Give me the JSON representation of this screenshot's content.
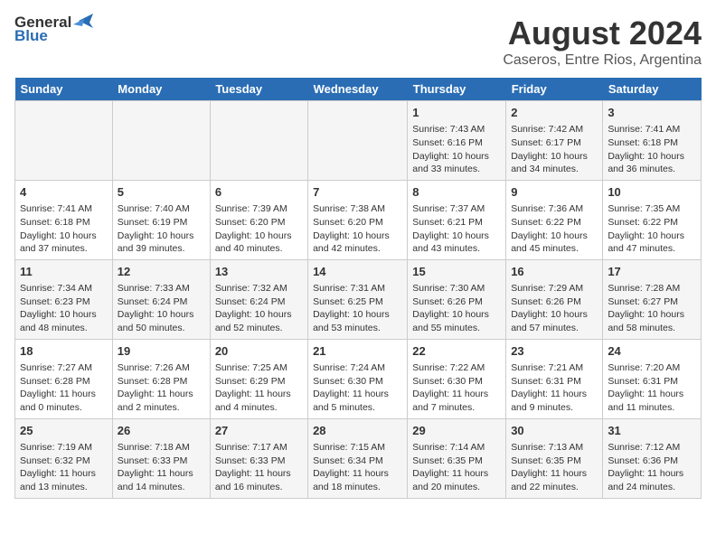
{
  "header": {
    "logo_general": "General",
    "logo_blue": "Blue",
    "month_title": "August 2024",
    "subtitle": "Caseros, Entre Rios, Argentina"
  },
  "days_of_week": [
    "Sunday",
    "Monday",
    "Tuesday",
    "Wednesday",
    "Thursday",
    "Friday",
    "Saturday"
  ],
  "weeks": [
    [
      {
        "day": "",
        "content": ""
      },
      {
        "day": "",
        "content": ""
      },
      {
        "day": "",
        "content": ""
      },
      {
        "day": "",
        "content": ""
      },
      {
        "day": "1",
        "content": "Sunrise: 7:43 AM\nSunset: 6:16 PM\nDaylight: 10 hours and 33 minutes."
      },
      {
        "day": "2",
        "content": "Sunrise: 7:42 AM\nSunset: 6:17 PM\nDaylight: 10 hours and 34 minutes."
      },
      {
        "day": "3",
        "content": "Sunrise: 7:41 AM\nSunset: 6:18 PM\nDaylight: 10 hours and 36 minutes."
      }
    ],
    [
      {
        "day": "4",
        "content": "Sunrise: 7:41 AM\nSunset: 6:18 PM\nDaylight: 10 hours and 37 minutes."
      },
      {
        "day": "5",
        "content": "Sunrise: 7:40 AM\nSunset: 6:19 PM\nDaylight: 10 hours and 39 minutes."
      },
      {
        "day": "6",
        "content": "Sunrise: 7:39 AM\nSunset: 6:20 PM\nDaylight: 10 hours and 40 minutes."
      },
      {
        "day": "7",
        "content": "Sunrise: 7:38 AM\nSunset: 6:20 PM\nDaylight: 10 hours and 42 minutes."
      },
      {
        "day": "8",
        "content": "Sunrise: 7:37 AM\nSunset: 6:21 PM\nDaylight: 10 hours and 43 minutes."
      },
      {
        "day": "9",
        "content": "Sunrise: 7:36 AM\nSunset: 6:22 PM\nDaylight: 10 hours and 45 minutes."
      },
      {
        "day": "10",
        "content": "Sunrise: 7:35 AM\nSunset: 6:22 PM\nDaylight: 10 hours and 47 minutes."
      }
    ],
    [
      {
        "day": "11",
        "content": "Sunrise: 7:34 AM\nSunset: 6:23 PM\nDaylight: 10 hours and 48 minutes."
      },
      {
        "day": "12",
        "content": "Sunrise: 7:33 AM\nSunset: 6:24 PM\nDaylight: 10 hours and 50 minutes."
      },
      {
        "day": "13",
        "content": "Sunrise: 7:32 AM\nSunset: 6:24 PM\nDaylight: 10 hours and 52 minutes."
      },
      {
        "day": "14",
        "content": "Sunrise: 7:31 AM\nSunset: 6:25 PM\nDaylight: 10 hours and 53 minutes."
      },
      {
        "day": "15",
        "content": "Sunrise: 7:30 AM\nSunset: 6:26 PM\nDaylight: 10 hours and 55 minutes."
      },
      {
        "day": "16",
        "content": "Sunrise: 7:29 AM\nSunset: 6:26 PM\nDaylight: 10 hours and 57 minutes."
      },
      {
        "day": "17",
        "content": "Sunrise: 7:28 AM\nSunset: 6:27 PM\nDaylight: 10 hours and 58 minutes."
      }
    ],
    [
      {
        "day": "18",
        "content": "Sunrise: 7:27 AM\nSunset: 6:28 PM\nDaylight: 11 hours and 0 minutes."
      },
      {
        "day": "19",
        "content": "Sunrise: 7:26 AM\nSunset: 6:28 PM\nDaylight: 11 hours and 2 minutes."
      },
      {
        "day": "20",
        "content": "Sunrise: 7:25 AM\nSunset: 6:29 PM\nDaylight: 11 hours and 4 minutes."
      },
      {
        "day": "21",
        "content": "Sunrise: 7:24 AM\nSunset: 6:30 PM\nDaylight: 11 hours and 5 minutes."
      },
      {
        "day": "22",
        "content": "Sunrise: 7:22 AM\nSunset: 6:30 PM\nDaylight: 11 hours and 7 minutes."
      },
      {
        "day": "23",
        "content": "Sunrise: 7:21 AM\nSunset: 6:31 PM\nDaylight: 11 hours and 9 minutes."
      },
      {
        "day": "24",
        "content": "Sunrise: 7:20 AM\nSunset: 6:31 PM\nDaylight: 11 hours and 11 minutes."
      }
    ],
    [
      {
        "day": "25",
        "content": "Sunrise: 7:19 AM\nSunset: 6:32 PM\nDaylight: 11 hours and 13 minutes."
      },
      {
        "day": "26",
        "content": "Sunrise: 7:18 AM\nSunset: 6:33 PM\nDaylight: 11 hours and 14 minutes."
      },
      {
        "day": "27",
        "content": "Sunrise: 7:17 AM\nSunset: 6:33 PM\nDaylight: 11 hours and 16 minutes."
      },
      {
        "day": "28",
        "content": "Sunrise: 7:15 AM\nSunset: 6:34 PM\nDaylight: 11 hours and 18 minutes."
      },
      {
        "day": "29",
        "content": "Sunrise: 7:14 AM\nSunset: 6:35 PM\nDaylight: 11 hours and 20 minutes."
      },
      {
        "day": "30",
        "content": "Sunrise: 7:13 AM\nSunset: 6:35 PM\nDaylight: 11 hours and 22 minutes."
      },
      {
        "day": "31",
        "content": "Sunrise: 7:12 AM\nSunset: 6:36 PM\nDaylight: 11 hours and 24 minutes."
      }
    ]
  ]
}
